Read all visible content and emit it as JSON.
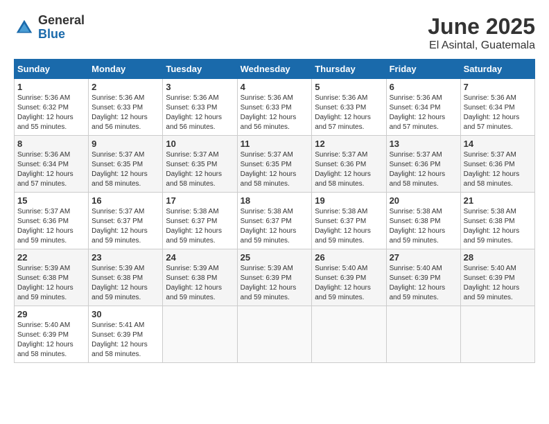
{
  "logo": {
    "general": "General",
    "blue": "Blue"
  },
  "title": {
    "month": "June 2025",
    "location": "El Asintal, Guatemala"
  },
  "weekdays": [
    "Sunday",
    "Monday",
    "Tuesday",
    "Wednesday",
    "Thursday",
    "Friday",
    "Saturday"
  ],
  "weeks": [
    [
      {
        "day": 1,
        "sunrise": "5:36 AM",
        "sunset": "6:32 PM",
        "daylight": "12 hours and 55 minutes."
      },
      {
        "day": 2,
        "sunrise": "5:36 AM",
        "sunset": "6:33 PM",
        "daylight": "12 hours and 56 minutes."
      },
      {
        "day": 3,
        "sunrise": "5:36 AM",
        "sunset": "6:33 PM",
        "daylight": "12 hours and 56 minutes."
      },
      {
        "day": 4,
        "sunrise": "5:36 AM",
        "sunset": "6:33 PM",
        "daylight": "12 hours and 56 minutes."
      },
      {
        "day": 5,
        "sunrise": "5:36 AM",
        "sunset": "6:33 PM",
        "daylight": "12 hours and 57 minutes."
      },
      {
        "day": 6,
        "sunrise": "5:36 AM",
        "sunset": "6:34 PM",
        "daylight": "12 hours and 57 minutes."
      },
      {
        "day": 7,
        "sunrise": "5:36 AM",
        "sunset": "6:34 PM",
        "daylight": "12 hours and 57 minutes."
      }
    ],
    [
      {
        "day": 8,
        "sunrise": "5:36 AM",
        "sunset": "6:34 PM",
        "daylight": "12 hours and 57 minutes."
      },
      {
        "day": 9,
        "sunrise": "5:37 AM",
        "sunset": "6:35 PM",
        "daylight": "12 hours and 58 minutes."
      },
      {
        "day": 10,
        "sunrise": "5:37 AM",
        "sunset": "6:35 PM",
        "daylight": "12 hours and 58 minutes."
      },
      {
        "day": 11,
        "sunrise": "5:37 AM",
        "sunset": "6:35 PM",
        "daylight": "12 hours and 58 minutes."
      },
      {
        "day": 12,
        "sunrise": "5:37 AM",
        "sunset": "6:36 PM",
        "daylight": "12 hours and 58 minutes."
      },
      {
        "day": 13,
        "sunrise": "5:37 AM",
        "sunset": "6:36 PM",
        "daylight": "12 hours and 58 minutes."
      },
      {
        "day": 14,
        "sunrise": "5:37 AM",
        "sunset": "6:36 PM",
        "daylight": "12 hours and 58 minutes."
      }
    ],
    [
      {
        "day": 15,
        "sunrise": "5:37 AM",
        "sunset": "6:36 PM",
        "daylight": "12 hours and 59 minutes."
      },
      {
        "day": 16,
        "sunrise": "5:37 AM",
        "sunset": "6:37 PM",
        "daylight": "12 hours and 59 minutes."
      },
      {
        "day": 17,
        "sunrise": "5:38 AM",
        "sunset": "6:37 PM",
        "daylight": "12 hours and 59 minutes."
      },
      {
        "day": 18,
        "sunrise": "5:38 AM",
        "sunset": "6:37 PM",
        "daylight": "12 hours and 59 minutes."
      },
      {
        "day": 19,
        "sunrise": "5:38 AM",
        "sunset": "6:37 PM",
        "daylight": "12 hours and 59 minutes."
      },
      {
        "day": 20,
        "sunrise": "5:38 AM",
        "sunset": "6:38 PM",
        "daylight": "12 hours and 59 minutes."
      },
      {
        "day": 21,
        "sunrise": "5:38 AM",
        "sunset": "6:38 PM",
        "daylight": "12 hours and 59 minutes."
      }
    ],
    [
      {
        "day": 22,
        "sunrise": "5:39 AM",
        "sunset": "6:38 PM",
        "daylight": "12 hours and 59 minutes."
      },
      {
        "day": 23,
        "sunrise": "5:39 AM",
        "sunset": "6:38 PM",
        "daylight": "12 hours and 59 minutes."
      },
      {
        "day": 24,
        "sunrise": "5:39 AM",
        "sunset": "6:38 PM",
        "daylight": "12 hours and 59 minutes."
      },
      {
        "day": 25,
        "sunrise": "5:39 AM",
        "sunset": "6:39 PM",
        "daylight": "12 hours and 59 minutes."
      },
      {
        "day": 26,
        "sunrise": "5:40 AM",
        "sunset": "6:39 PM",
        "daylight": "12 hours and 59 minutes."
      },
      {
        "day": 27,
        "sunrise": "5:40 AM",
        "sunset": "6:39 PM",
        "daylight": "12 hours and 59 minutes."
      },
      {
        "day": 28,
        "sunrise": "5:40 AM",
        "sunset": "6:39 PM",
        "daylight": "12 hours and 59 minutes."
      }
    ],
    [
      {
        "day": 29,
        "sunrise": "5:40 AM",
        "sunset": "6:39 PM",
        "daylight": "12 hours and 58 minutes."
      },
      {
        "day": 30,
        "sunrise": "5:41 AM",
        "sunset": "6:39 PM",
        "daylight": "12 hours and 58 minutes."
      },
      null,
      null,
      null,
      null,
      null
    ]
  ]
}
